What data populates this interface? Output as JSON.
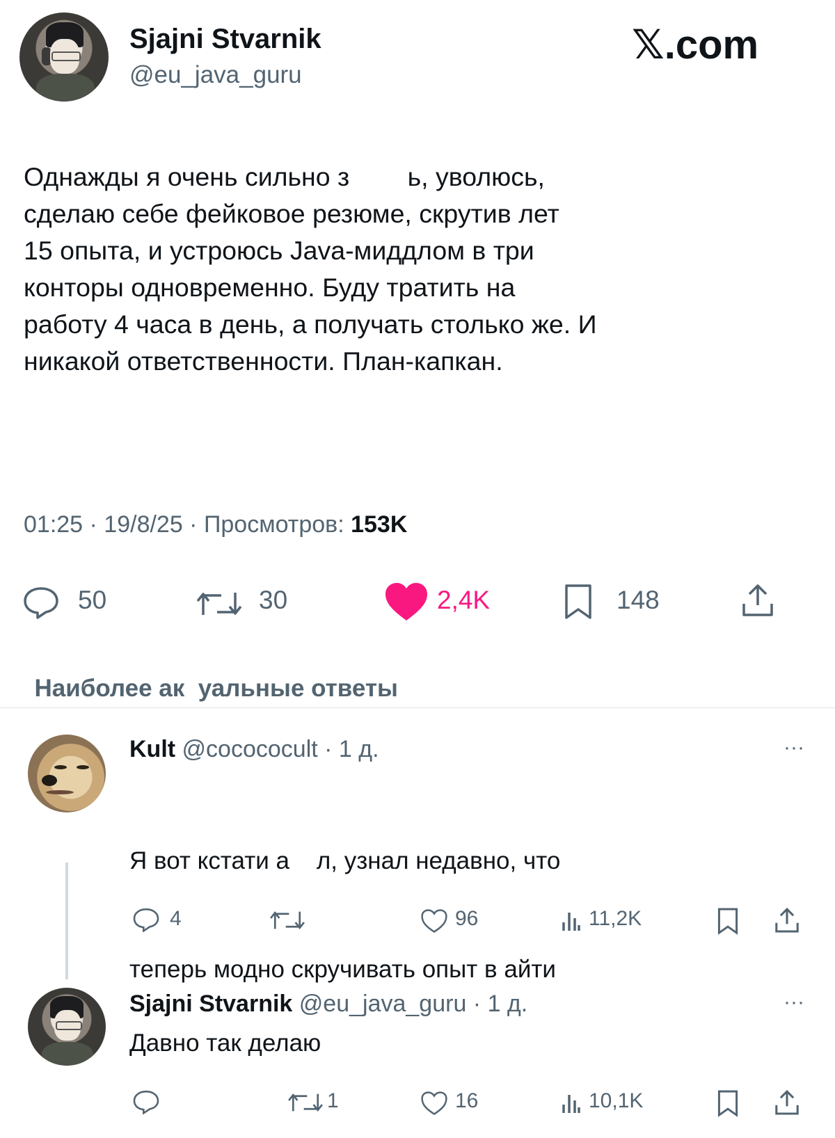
{
  "post": {
    "author_name": "Sjajni Stvarnik",
    "handle": "@eu_java_guru",
    "brand": "𝕏.com",
    "text_lines": [
      "Однажды я очень сильно з        ь, уволюсь,",
      "сделаю себе фейковое резюме, скрутив лет",
      "15 опыта, и устроюсь Java-миддлом в три",
      "конторы одновременно. Буду тратить на",
      "работу 4 часа в день, а получать столько же. И",
      "никакой ответственности. План-капкан."
    ],
    "meta_prefix": "01:25 · 19/8/25 · Просмотров: ",
    "views": "153K",
    "metrics": {
      "replies": "50",
      "reposts": "30",
      "likes": "2,4K",
      "bookmarks": "148"
    },
    "like_color": "#f91880"
  },
  "replies_sort": {
    "label": "Наиболее ак  уальные ответы"
  },
  "replies": [
    {
      "name": "Kult",
      "handle_time": "@cocococult · 1 д.",
      "text_lines": [
        "Я вот кстати а    л, узнал недавно, что",
        "теперь модно скручивать опыт в айти"
      ],
      "metrics": {
        "replies": "4",
        "reposts": "",
        "likes": "96",
        "views": "11,2K"
      }
    },
    {
      "name": "Sjajni Stvarnik",
      "handle_time": "@eu_java_guru · 1 д.",
      "text_lines": [
        "Давно так делаю"
      ],
      "metrics": {
        "replies": "",
        "reposts": "1",
        "likes": "16",
        "views": "10,1K"
      }
    }
  ]
}
